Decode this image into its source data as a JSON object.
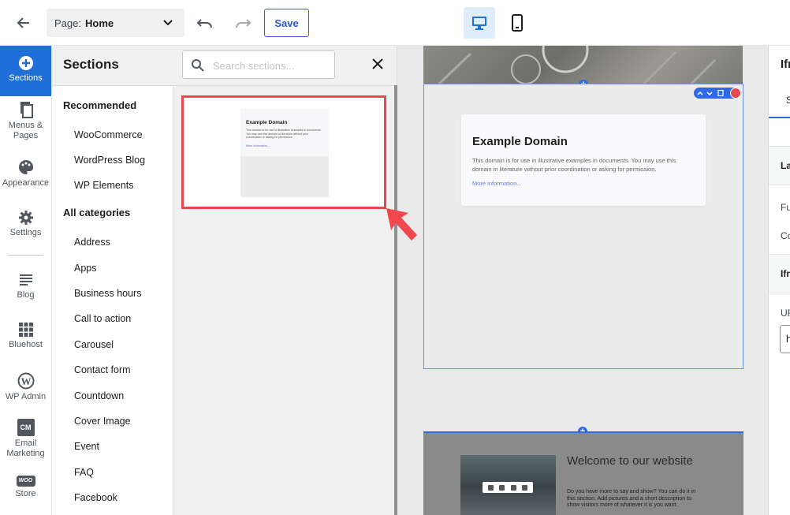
{
  "topbar": {
    "page_label": "Page:",
    "page_value": "Home",
    "save_label": "Save"
  },
  "leftnav": {
    "items": [
      {
        "label": "Sections",
        "icon": "plus-circle-icon",
        "active": true
      },
      {
        "label": "Menus & Pages",
        "icon": "pages-icon"
      },
      {
        "label": "Appearance",
        "icon": "palette-icon"
      },
      {
        "label": "Settings",
        "icon": "gear-icon"
      },
      {
        "label": "Blog",
        "icon": "blog-icon"
      },
      {
        "label": "Bluehost",
        "icon": "grid-icon"
      },
      {
        "label": "WP Admin",
        "icon": "wordpress-icon"
      },
      {
        "label": "Email Marketing",
        "icon": "cm-icon",
        "badge": "CM"
      },
      {
        "label": "Store",
        "icon": "woo-icon",
        "badge": "WOO"
      }
    ]
  },
  "sections_panel": {
    "title": "Sections",
    "search_placeholder": "Search sections...",
    "recommended_heading": "Recommended",
    "recommended": [
      "WooCommerce",
      "WordPress Blog",
      "WP Elements"
    ],
    "all_heading": "All categories",
    "categories": [
      "Address",
      "Apps",
      "Business hours",
      "Call to action",
      "Carousel",
      "Contact form",
      "Countdown",
      "Cover Image",
      "Event",
      "FAQ",
      "Facebook"
    ],
    "thumbnail": {
      "title": "Example Domain",
      "body": "This domain is for use in illustrative examples in documents. You may use this domain in literature without prior coordination or asking for permission.",
      "link": "More information..."
    }
  },
  "canvas": {
    "iframe_section": {
      "title": "Example Domain",
      "body": "This domain is for use in illustrative examples in documents. You may use this domain in literature without prior coordination or asking for permission.",
      "link": "More information..."
    },
    "welcome_section": {
      "title": "Welcome to our website",
      "body": "Do you have more to say and show? You can do it in this section. Add pictures and a short description to show visitors more of whatever it is you want."
    }
  },
  "right_panel": {
    "title": "Ifr",
    "tab": "S",
    "band1": "La",
    "label1": "Fu",
    "label2": "Co",
    "band2": "Ifr",
    "label3": "UF",
    "input_value": "h"
  },
  "colors": {
    "accent": "#1e6fd9",
    "highlight_border": "#e5484d",
    "arrow": "#f0484d"
  }
}
